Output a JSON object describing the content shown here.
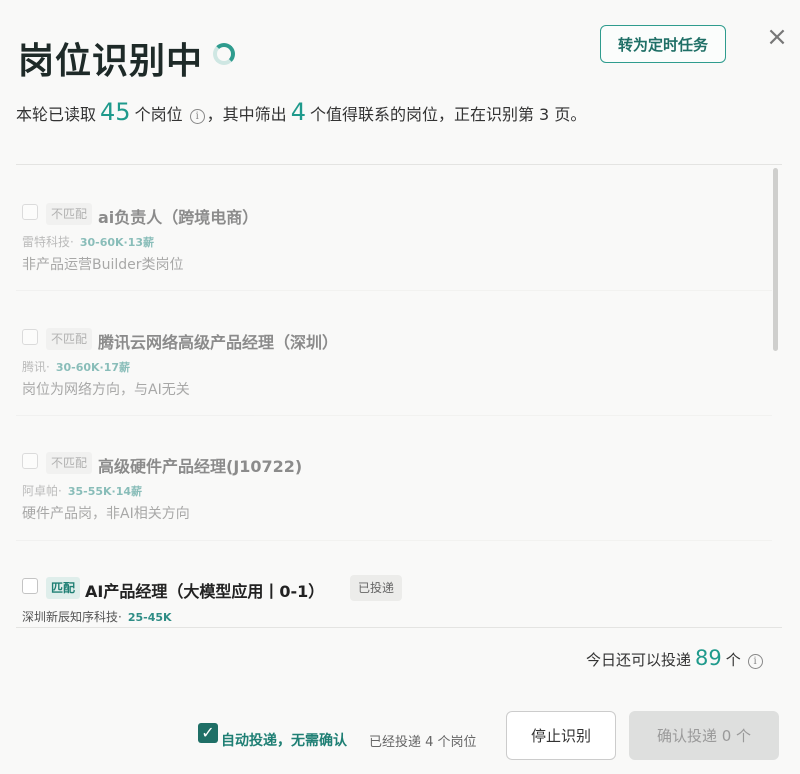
{
  "header": {
    "title": "岗位识别中",
    "schedule_label": "转为定时任务",
    "close_glyph": "×"
  },
  "summary": {
    "part1": "本轮已读取",
    "read_count": "45",
    "part2": "个岗位",
    "info": "i",
    "part3": "，其中筛出",
    "filtered_count": "4",
    "part4": "个值得联系的岗位，正在识别第 3 页。"
  },
  "jobs": [
    {
      "tag": "不匹配",
      "title": "ai负责人（跨境电商）",
      "company": "雷特科技·",
      "salary": "30-60K·13薪",
      "reason": "非产品运营Builder类岗位"
    },
    {
      "tag": "不匹配",
      "title": "腾讯云网络高级产品经理（深圳）",
      "company": "腾讯·",
      "salary": "30-60K·17薪",
      "reason": "岗位为网络方向，与AI无关"
    },
    {
      "tag": "不匹配",
      "title": "高级硬件产品经理(J10722)",
      "company": "阿卓帕·",
      "salary": "35-55K·14薪",
      "reason": "硬件产品岗，非AI相关方向"
    },
    {
      "tag": "匹配",
      "title": "AI产品经理（大模型应用丨0-1）",
      "badge": "已投递",
      "company": "深圳新辰知序科技·",
      "salary": "25-45K"
    }
  ],
  "footer": {
    "today_prefix": "今日还可以投递",
    "today_count": "89",
    "today_suffix": "个",
    "info": "i",
    "check_glyph": "✓",
    "auto_label": "自动投递，无需确认",
    "sent_note": "已经投递 4 个岗位",
    "stop_label": "停止识别",
    "confirm_label": "确认投递 0 个"
  },
  "colors": {
    "accent": "#1f9a8c",
    "accent_dark": "#1f6f66"
  }
}
